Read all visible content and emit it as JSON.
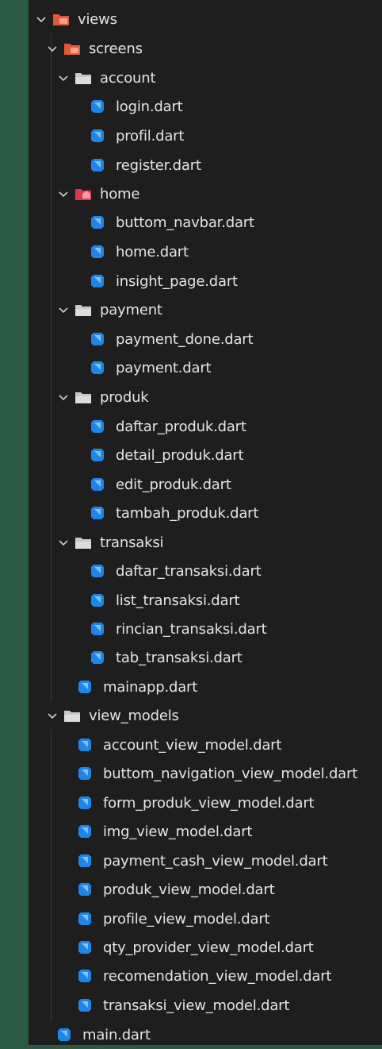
{
  "explorer": {
    "views": {
      "label": "views",
      "screens": {
        "label": "screens",
        "account": {
          "label": "account",
          "files": [
            "login.dart",
            "profil.dart",
            "register.dart"
          ]
        },
        "home": {
          "label": "home",
          "files": [
            "buttom_navbar.dart",
            "home.dart",
            "insight_page.dart"
          ]
        },
        "payment": {
          "label": "payment",
          "files": [
            "payment_done.dart",
            "payment.dart"
          ]
        },
        "produk": {
          "label": "produk",
          "files": [
            "daftar_produk.dart",
            "detail_produk.dart",
            "edit_produk.dart",
            "tambah_produk.dart"
          ]
        },
        "transaksi": {
          "label": "transaksi",
          "files": [
            "daftar_transaksi.dart",
            "list_transaksi.dart",
            "rincian_transaksi.dart",
            "tab_transaksi.dart"
          ]
        }
      },
      "mainapp": "mainapp.dart"
    },
    "view_models": {
      "label": "view_models",
      "files": [
        "account_view_model.dart",
        "buttom_navigation_view_model.dart",
        "form_produk_view_model.dart",
        "img_view_model.dart",
        "payment_cash_view_model.dart",
        "produk_view_model.dart",
        "profile_view_model.dart",
        "qty_provider_view_model.dart",
        "recomendation_view_model.dart",
        "transaksi_view_model.dart"
      ]
    },
    "main": "main.dart"
  },
  "colors": {
    "background_outer": "#2a5a41",
    "panel": "#1e1e1e",
    "text": "#e4e4e4",
    "chevron": "#cfcfcf",
    "folder_special": "#e05a3a",
    "folder_plain": "#c8c8c8",
    "dart_icon": "#1f86e8"
  },
  "icons": {
    "chevron": "chevron-down-icon",
    "folder_special": "folder-views-icon",
    "folder_home": "folder-home-icon",
    "folder": "folder-open-icon",
    "dart": "dart-file-icon"
  }
}
